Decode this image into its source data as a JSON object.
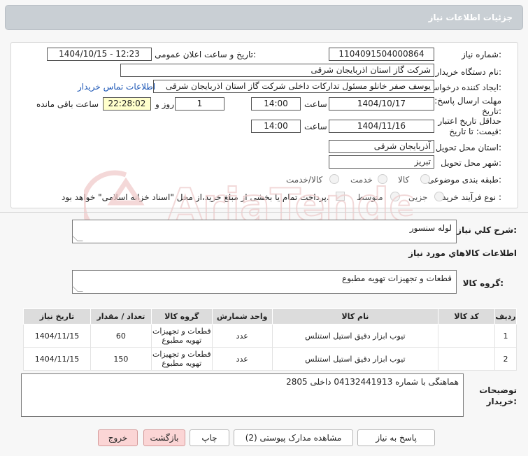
{
  "header": {
    "title": "جزئیات اطلاعات نیاز"
  },
  "form": {
    "need_number_label": "شماره نیاز:",
    "need_number": "1104091504000864",
    "announce_label": "تاریخ و ساعت اعلان عمومی:",
    "announce_value": "1404/10/15 - 12:23",
    "buyer_org_label": "نام دستگاه خریدار:",
    "buyer_org": "شرکت گاز استان اذربایجان شرقی",
    "requester_label": "ایجاد کننده درخواست:",
    "requester": "یوسف صفر خانلو  مسئول تدارکات داخلی  شرکت گاز استان اذربایجان شرقی",
    "contact_link": "اطلاعات تماس خریدار",
    "deadline_label_1": "مهلت ارسال پاسخ: تا",
    "deadline_label_2": "تاریخ:",
    "deadline_date": "1404/10/17",
    "time_label": "ساعت",
    "deadline_time": "14:00",
    "days_value": "1",
    "days_label": "روز و",
    "remaining_time": "22:28:02",
    "remaining_label": "ساعت باقی مانده",
    "validity_label_1": "حداقل تاریخ اعتبار",
    "validity_label_2": "قیمت: تا تاریخ:",
    "validity_date": "1404/11/16",
    "validity_time": "14:00",
    "province_label": "استان محل تحویل:",
    "province": "آذربایجان شرقی",
    "city_label": "شهر محل تحویل:",
    "city": "تبریز",
    "category_label": "طبقه بندی موضوعی:",
    "category_options": [
      "کالا",
      "خدمت",
      "کالا/خدمت"
    ],
    "process_label": "نوع فرآیند خرید :",
    "process_options": [
      "جزیی",
      "متوسط"
    ],
    "payment_note": "پرداخت تمام یا بخشی از مبلغ خرید،از محل \"اسناد خزانه اسلامی\" خواهد بود."
  },
  "summary": {
    "label": "شرح کلي نياز:",
    "value": "لوله سنسور"
  },
  "goods_info_title": "اطلاعات کالاهاي مورد نياز",
  "goods_group": {
    "label": "گروه کالا:",
    "value": "قطعات و تجهیزات تهویه مطبوع"
  },
  "table": {
    "headers": [
      "ردیف",
      "کد کالا",
      "نام کالا",
      "واحد شمارش",
      "گروه کالا",
      "تعداد / مقدار",
      "تاریخ نیاز"
    ],
    "rows": [
      {
        "row": "1",
        "code": "",
        "name": "تیوب ابزار دقیق استیل استنلس",
        "unit": "عدد",
        "group_1": "قطعات و تجهیزات",
        "group_2": "تهویه مطبوع",
        "qty": "60",
        "date": "1404/11/15"
      },
      {
        "row": "2",
        "code": "",
        "name": "تیوب ابزار دقیق استیل استنلس",
        "unit": "عدد",
        "group_1": "قطعات و تجهیزات",
        "group_2": "تهویه مطبوع",
        "qty": "150",
        "date": "1404/11/15"
      }
    ]
  },
  "buyer_notes": {
    "label_1": "توضیحات",
    "label_2": "خریدار:",
    "value": "هماهنگی با شماره 04132441913 داخلی 2805"
  },
  "buttons": {
    "reply": "پاسخ به نیاز",
    "attachments": "مشاهده مدارک پیوستی (2)",
    "print": "چاپ",
    "back": "بازگشت",
    "exit": "خروج"
  },
  "colors": {
    "link": "#1a55b5",
    "highlight": "#ffffcc",
    "danger_button": "#fbd5d5",
    "title_bar": "#c9cfd4"
  }
}
